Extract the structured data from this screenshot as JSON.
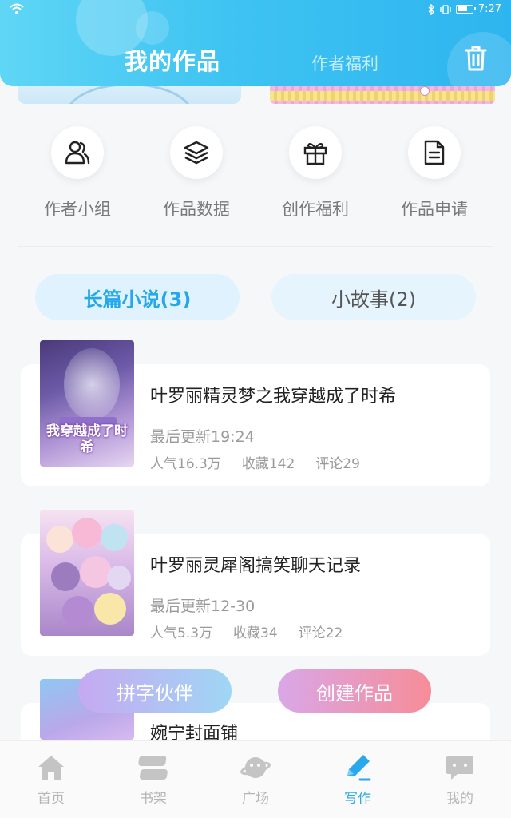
{
  "status_bar": {
    "time": "7:27"
  },
  "header": {
    "title": "我的作品",
    "subtitle": "作者福利"
  },
  "quick_menu": [
    {
      "label": "作者小组",
      "icon": "users-icon"
    },
    {
      "label": "作品数据",
      "icon": "layers-icon"
    },
    {
      "label": "创作福利",
      "icon": "gift-icon"
    },
    {
      "label": "作品申请",
      "icon": "document-icon"
    }
  ],
  "tabs": [
    {
      "label": "长篇小说(3)",
      "active": true
    },
    {
      "label": "小故事(2)",
      "active": false
    }
  ],
  "works": [
    {
      "title": "叶罗丽精灵梦之我穿越成了时希",
      "updated": "最后更新19:24",
      "popularity": "人气16.3万",
      "favorites": "收藏142",
      "comments": "评论29",
      "cover_text": "我穿越成了时希"
    },
    {
      "title": "叶罗丽灵犀阁搞笑聊天记录",
      "updated": "最后更新12-30",
      "popularity": "人气5.3万",
      "favorites": "收藏34",
      "comments": "评论22"
    },
    {
      "title": "婉宁封面铺"
    }
  ],
  "floating_buttons": {
    "left": "拼字伙伴",
    "right": "创建作品"
  },
  "bottom_nav": [
    {
      "label": "首页",
      "icon": "home-icon",
      "active": false
    },
    {
      "label": "书架",
      "icon": "bookshelf-icon",
      "active": false
    },
    {
      "label": "广场",
      "icon": "planet-icon",
      "active": false
    },
    {
      "label": "写作",
      "icon": "pen-icon",
      "active": true
    },
    {
      "label": "我的",
      "icon": "chat-bubble-icon",
      "active": false
    }
  ],
  "colors": {
    "accent": "#2aa8ec",
    "header_start": "#5fd6f5",
    "header_end": "#2eb5ef",
    "create_start": "#d9a7e8",
    "create_end": "#f78c98"
  }
}
